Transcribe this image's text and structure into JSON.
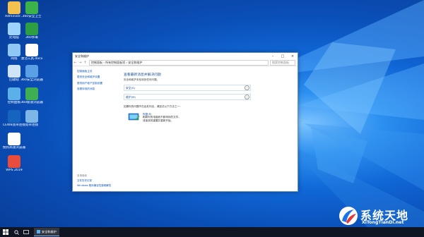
{
  "desktop": {
    "icons": [
      {
        "label": "Administr...",
        "name": "user-folder-icon",
        "color": "#f2c14e"
      },
      {
        "label": "360安全卫士",
        "name": "shield-360-icon",
        "color": "#3cb34a"
      },
      {
        "label": "此电脑",
        "name": "this-pc-icon",
        "color": "#9dd3ff"
      },
      {
        "label": "360杀毒",
        "name": "antivirus-360-icon",
        "color": "#2e9e45"
      },
      {
        "label": "网络",
        "name": "network-icon",
        "color": "#8fc8f5"
      },
      {
        "label": "激活工具.docx",
        "name": "doc-file-icon",
        "color": "#ffffff"
      },
      {
        "label": "回收站",
        "name": "recycle-bin-icon",
        "color": "#cfe4f7"
      },
      {
        "label": "360安全浏览器",
        "name": "browser-360-icon",
        "color": "#5aa0e6"
      },
      {
        "label": "控制面板",
        "name": "control-panel-icon",
        "color": "#5bb0ea"
      },
      {
        "label": "360极速浏览器",
        "name": "browser-360-speed-icon",
        "color": "#3fae52"
      },
      {
        "label": "CEWB宽带连接",
        "name": "broadband-icon",
        "color": "#1565c0"
      },
      {
        "label": "宽带连接",
        "name": "connect-icon",
        "color": "#7cb7e8"
      },
      {
        "label": "搜狗高速浏览器",
        "name": "sogou-browser-icon",
        "color": "#ffffff"
      },
      {
        "label": "WPS 2019",
        "name": "wps-icon",
        "color": "#e84c3d"
      }
    ]
  },
  "window": {
    "title": "安全和维护",
    "address": [
      "控制面板",
      "所有控制面板项",
      "安全和维护"
    ],
    "search_placeholder": "搜索控制面板",
    "sidebar": [
      "控制面板主页",
      "更改安全和维护设置",
      "更改用户帐户控制设置",
      "查看存档的消息"
    ],
    "heading": "查看最新消息并解决问题",
    "subheading": "安全和维护未检测到任何问题。",
    "sections": [
      {
        "label": "安全(S)"
      },
      {
        "label": "维护(M)"
      }
    ],
    "note": "如果你的问题不在此处列出，请尝试以下方法之一：",
    "recovery": {
      "title": "恢复(R)",
      "desc1": "刷新你的电脑而不影响你的文件，",
      "desc2": "或者将其重置并重新开始。"
    },
    "see_also": {
      "heading": "另请参阅",
      "items": [
        "文件历史记录",
        "Windows 程序兼容性疑难解答"
      ]
    }
  },
  "taskbar": {
    "active_app": "安全和维护"
  },
  "watermark": {
    "title": "系统天地",
    "url": "XiTongTianDi.net"
  }
}
